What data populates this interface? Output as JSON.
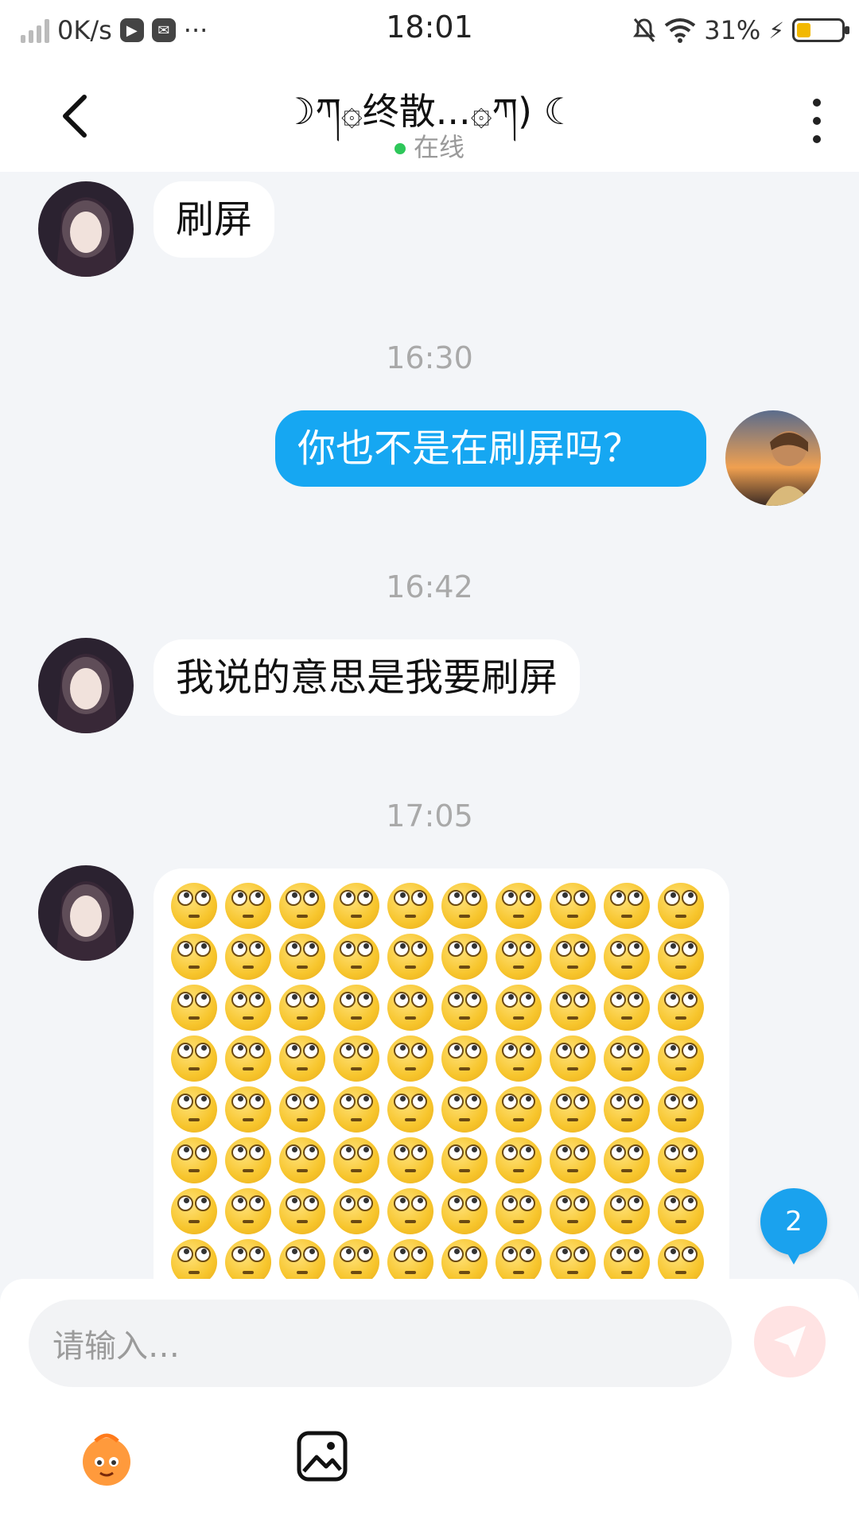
{
  "status_bar": {
    "net_speed": "0K/s",
    "time": "18:01",
    "battery": "31%",
    "battery_level": 0.31,
    "icons": [
      "signal-icon",
      "play-icon",
      "message-icon",
      "more-icon",
      "mute-bell-icon",
      "wifi-icon",
      "charging-icon",
      "battery-icon"
    ]
  },
  "header": {
    "title": "☽ཀ۞终散...۞ཀ) ☾",
    "status": "在线"
  },
  "messages": {
    "m1": {
      "text": "刷屏"
    },
    "t1": "16:30",
    "m2": {
      "text": "你也不是在刷屏吗？"
    },
    "t2": "16:42",
    "m3": {
      "text": "我说的意思是我要刷屏"
    },
    "t3": "17:05",
    "m4": {
      "emoji": "face-with-rolling-eyes",
      "visible_count": 80
    }
  },
  "new_badge": "2",
  "composer": {
    "placeholder": "请输入…"
  },
  "colors": {
    "outgoing_bubble": "#16a7f2",
    "incoming_bubble": "#ffffff",
    "background": "#f3f5f8",
    "online_dot": "#2ec75a",
    "badge": "#1aa2ee"
  }
}
